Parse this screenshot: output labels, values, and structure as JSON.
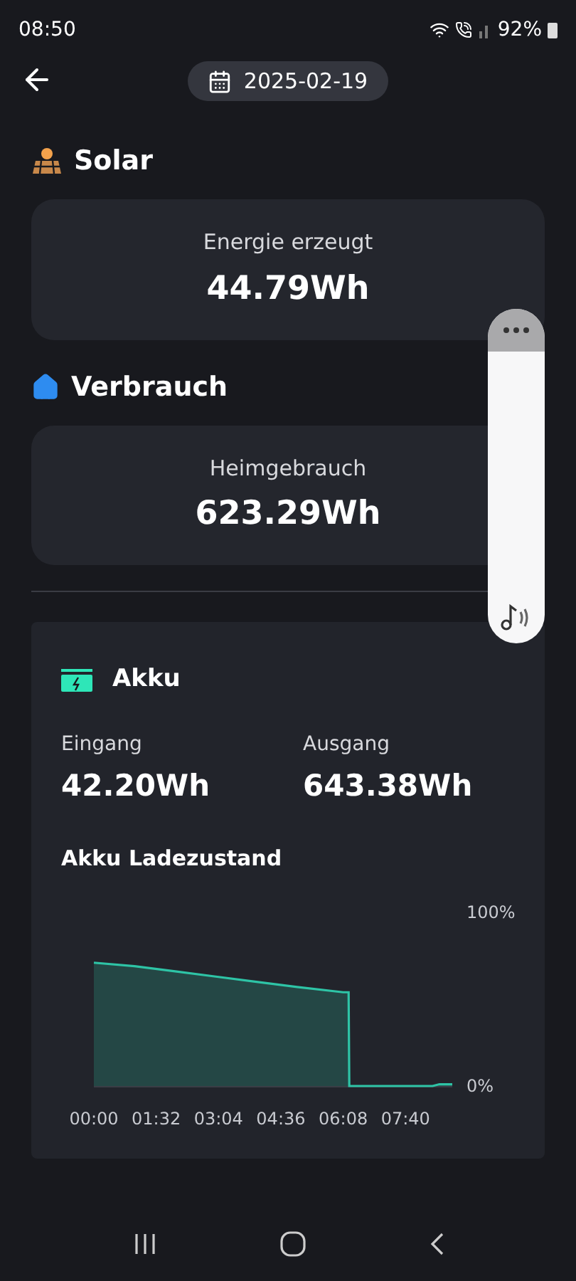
{
  "status_bar": {
    "time": "08:50",
    "battery": "92%"
  },
  "header": {
    "date": "2025-02-19"
  },
  "solar": {
    "title": "Solar",
    "label": "Energie erzeugt",
    "value": "44.79Wh"
  },
  "consumption": {
    "title": "Verbrauch",
    "label": "Heimgebrauch",
    "value": "623.29Wh"
  },
  "battery": {
    "title": "Akku",
    "stats": [
      {
        "label": "Eingang",
        "value": "42.20Wh"
      },
      {
        "label": "Ausgang",
        "value": "643.38Wh"
      }
    ],
    "chart_title": "Akku Ladezustand",
    "chart_data": {
      "type": "area",
      "x": [
        0,
        60,
        120,
        180,
        240,
        300,
        368,
        376,
        377,
        500,
        510,
        529
      ],
      "series": [
        {
          "color": "#2ec4a6",
          "values": [
            71,
            69,
            66,
            63,
            60,
            57,
            54,
            54,
            0,
            0,
            1,
            1
          ]
        }
      ],
      "xlim": [
        0,
        529
      ],
      "ylim": [
        0,
        100
      ],
      "xticks": [
        {
          "value": 0,
          "label": "00:00"
        },
        {
          "value": 92,
          "label": "01:32"
        },
        {
          "value": 184,
          "label": "03:04"
        },
        {
          "value": 276,
          "label": "04:36"
        },
        {
          "value": 368,
          "label": "06:08"
        },
        {
          "value": 460,
          "label": "07:40"
        }
      ],
      "yticks": [
        {
          "value": 0,
          "label": "0%"
        },
        {
          "value": 100,
          "label": "100%"
        }
      ]
    }
  }
}
